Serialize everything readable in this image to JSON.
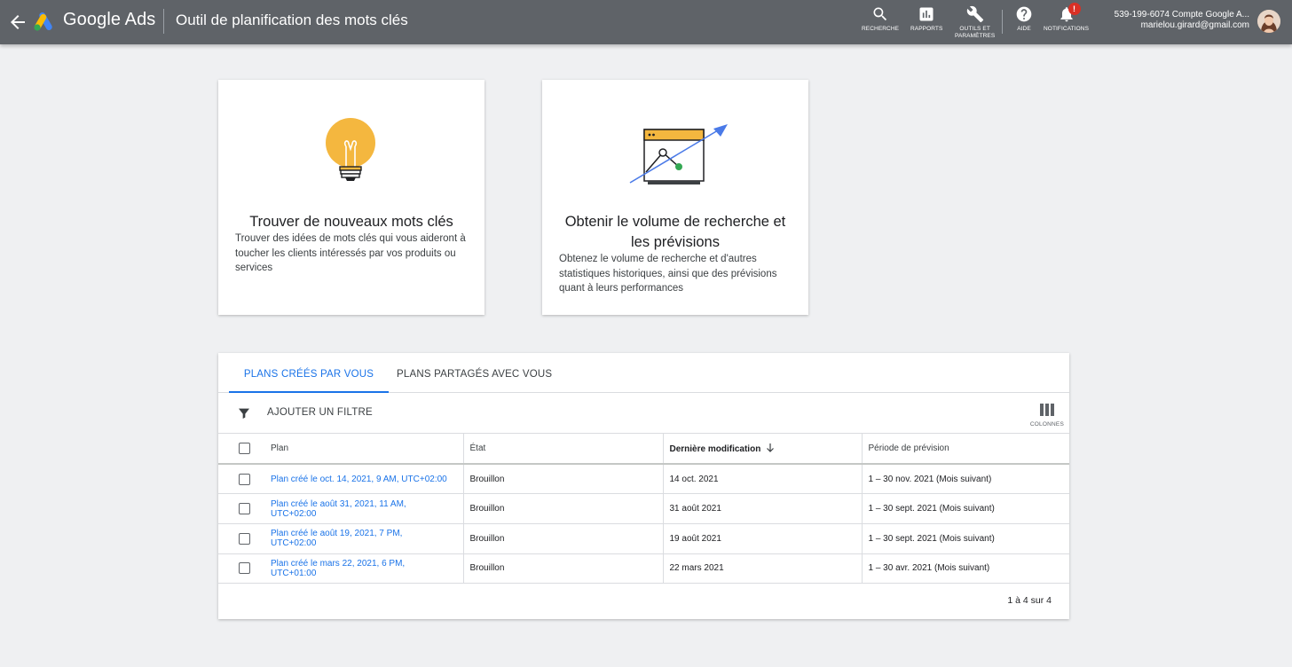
{
  "topbar": {
    "product_name": "Google Ads",
    "page_title": "Outil de planification des mots clés",
    "buttons": [
      {
        "icon": "search-icon",
        "label": "RECHERCHE"
      },
      {
        "icon": "reports-icon",
        "label": "RAPPORTS"
      },
      {
        "icon": "wrench-icon",
        "label_line1": "OUTILS ET",
        "label_line2": "PARAMÈTRES"
      },
      {
        "icon": "help-icon",
        "label": "AIDE"
      },
      {
        "icon": "bell-icon",
        "label": "NOTIFICATIONS",
        "badge": "!"
      }
    ],
    "account": {
      "line1": "539-199-6074 Compte Google A...",
      "line2": "marielou.girard@gmail.com"
    }
  },
  "cards": [
    {
      "icon": "lightbulb-icon",
      "title": "Trouver de nouveaux mots clés",
      "description": "Trouver des idées de mots clés qui vous aideront à toucher les clients intéressés par vos produits ou services"
    },
    {
      "icon": "forecast-chart-icon",
      "title_line1": "Obtenir le volume de recherche et",
      "title_line2": "les prévisions",
      "description": "Obtenez le volume de recherche et d'autres statistiques historiques, ainsi que des prévisions quant à leurs performances"
    }
  ],
  "plans": {
    "tabs": [
      {
        "label": "PLANS CRÉÉS PAR VOUS",
        "active": true
      },
      {
        "label": "PLANS PARTAGÉS AVEC VOUS",
        "active": false
      }
    ],
    "filter_label": "AJOUTER UN FILTRE",
    "columns_label": "COLONNES",
    "headers": {
      "plan": "Plan",
      "state": "État",
      "last_modified": "Dernière modification",
      "forecast_period": "Période de prévision"
    },
    "rows": [
      {
        "plan_line1": "Plan créé le oct. 14, 2021, 9 AM, UTC+02:00",
        "plan_line2": "",
        "state": "Brouillon",
        "last_modified": "14 oct. 2021",
        "forecast_period": "1 – 30 nov. 2021 (Mois suivant)"
      },
      {
        "plan_line1": "Plan créé le août 31, 2021, 11 AM,",
        "plan_line2": "UTC+02:00",
        "state": "Brouillon",
        "last_modified": "31 août 2021",
        "forecast_period": "1 – 30 sept. 2021 (Mois suivant)"
      },
      {
        "plan_line1": "Plan créé le août 19, 2021, 7 PM,",
        "plan_line2": "UTC+02:00",
        "state": "Brouillon",
        "last_modified": "19 août 2021",
        "forecast_period": "1 – 30 sept. 2021 (Mois suivant)"
      },
      {
        "plan_line1": "Plan créé le mars 22, 2021, 6 PM,",
        "plan_line2": "UTC+01:00",
        "state": "Brouillon",
        "last_modified": "22 mars 2021",
        "forecast_period": "1 – 30 avr. 2021 (Mois suivant)"
      }
    ],
    "pagination": "1 à 4 sur 4"
  },
  "colors": {
    "topbar": "#5f6368",
    "accent_blue": "#1a73e8",
    "logo_yellow": "#fbbc04",
    "logo_blue": "#4285f4",
    "logo_green": "#34a853",
    "badge_red": "#d93025"
  }
}
